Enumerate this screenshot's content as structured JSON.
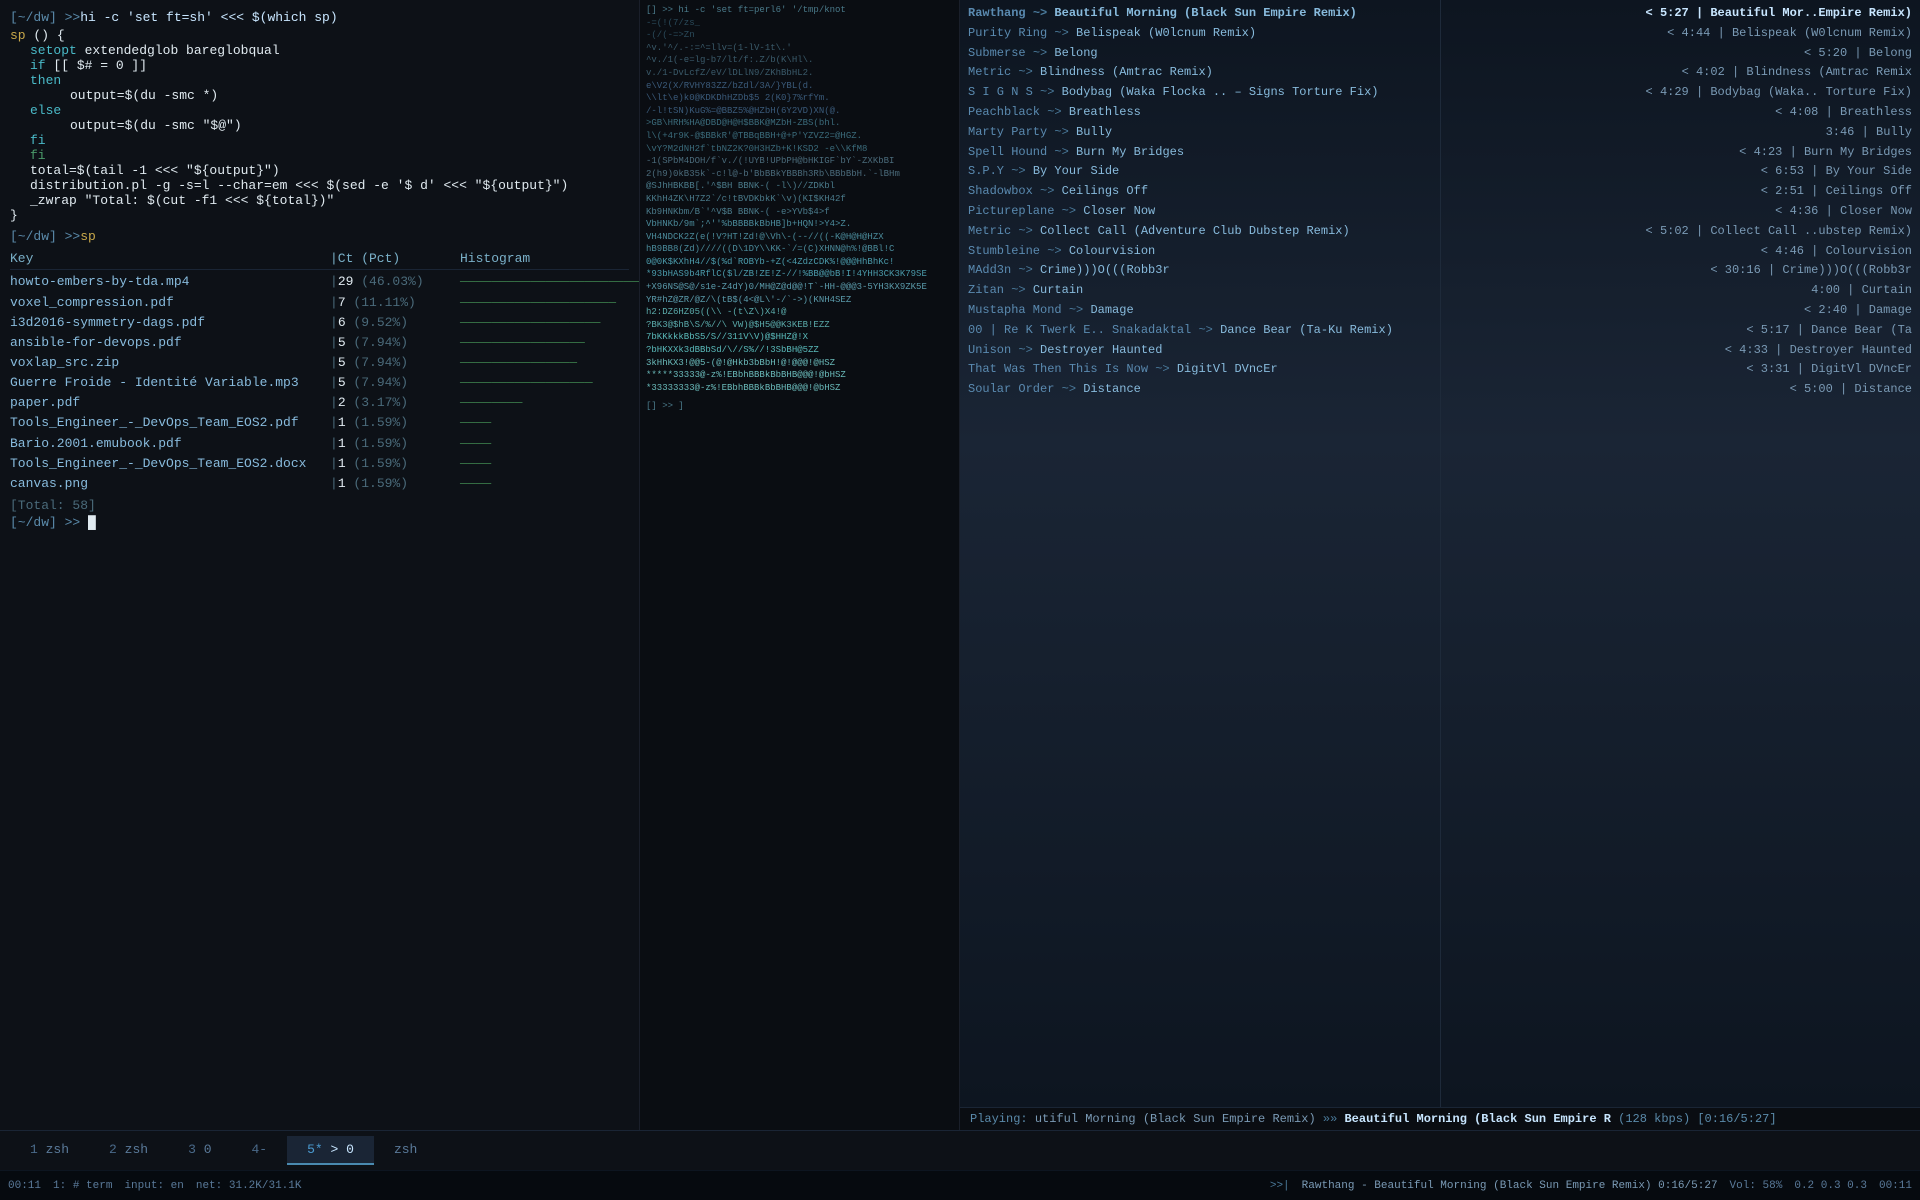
{
  "left_terminal": {
    "lines": [
      {
        "type": "prompt",
        "text": "[~/dw] >> hi -c 'set ft=sh' <<< $(which sp)"
      },
      {
        "type": "code",
        "text": "sp () {"
      },
      {
        "type": "code",
        "text": "    setopt extendedglob bareglobqual"
      },
      {
        "type": "code",
        "text": "    if [[ $# = 0 ]]"
      },
      {
        "type": "code",
        "text": "    then"
      },
      {
        "type": "code",
        "text": "            output=$(du -smc *)"
      },
      {
        "type": "code",
        "text": "    else"
      },
      {
        "type": "code",
        "text": "            output=$(du -smc \"$@\")"
      },
      {
        "type": "code",
        "text": "    fi"
      },
      {
        "type": "keyword",
        "text": "    fi"
      },
      {
        "type": "code",
        "text": "    total=$(tail -1 <<< \"${output}\")"
      },
      {
        "type": "code",
        "text": "    distribution.pl -g -s=l --char=em <<< $(sed -e '$ d' <<< \"${output}\")"
      },
      {
        "type": "code",
        "text": "    _zwrap \"Total: $(cut -f1 <<< ${total})\""
      },
      {
        "type": "code",
        "text": "}"
      },
      {
        "type": "prompt2",
        "text": "[~/dw] >> sp"
      }
    ],
    "sp_output": {
      "header": {
        "key": "Key",
        "ct": "Ct (Pct)",
        "histogram": "Histogram"
      },
      "rows": [
        {
          "key": "howto-embers-by-tda.mp4",
          "ct": "29",
          "pct": "46.03%",
          "bars": 29
        },
        {
          "key": "voxel_compression.pdf",
          "ct": "7",
          "pct": "11.11%",
          "bars": 7
        },
        {
          "key": "i3d2016-symmetry-dags.pdf",
          "ct": "6",
          "pct": "9.52%",
          "bars": 6
        },
        {
          "key": "ansible-for-devops.pdf",
          "ct": "5",
          "pct": "7.94%",
          "bars": 5
        },
        {
          "key": "voxlap_src.zip",
          "ct": "5",
          "pct": "7.94%",
          "bars": 5
        },
        {
          "key": "Guerre Froide - Identité Variable.mp3",
          "ct": "5",
          "pct": "7.94%",
          "bars": 5
        },
        {
          "key": "paper.pdf",
          "ct": "2",
          "pct": "3.17%",
          "bars": 2
        },
        {
          "key": "Tools_Engineer_-_DevOps_Team_EOS2.pdf",
          "ct": "1",
          "pct": "1.59%",
          "bars": 1
        },
        {
          "key": "Bario.2001.emubook.pdf",
          "ct": "1",
          "pct": "1.59%",
          "bars": 1
        },
        {
          "key": "Tools_Engineer_-_DevOps_Team_EOS2.docx",
          "ct": "1",
          "pct": "1.59%",
          "bars": 1
        },
        {
          "key": "canvas.png",
          "ct": "1",
          "pct": "1.59%",
          "bars": 1
        }
      ],
      "total": "[Total: 58]",
      "cursor": "[~/dw] >> "
    }
  },
  "right_terminal": {
    "header": "[] >> hi -c 'set ft=perl6' '/tmp/knot",
    "lines_top": [
      "-=(!(7/zs_",
      "-(/(-=>Zn",
      "^v.'^/.-:=^=llv=(1-lV-1t\\.'",
      "^v./1(-e=lg-b7/lt/f:.Z/b(K\\Hl\\.",
      "v./1-DvLcfZ/eV/lDLlN9/ZKhBbHL2.",
      "e\\V2(X/RVHY83ZZ/bZdl/3A/}YBL(d.",
      "\\\\lt\\e)k0@KDKDhHZDb$5 2(K0}7%rfYm.",
      "/-l!tSN)KuG%=@BBZ5%@HZbH(6Y2VD)XN(@.",
      ">GB\\HRH%HA@DBD@H@H$BBK@MZbH-ZBS(bhl.",
      "l\\(+4r9K-@$BBkR'@TBBqBBH+@+P'YZVZ2=@HGZ.",
      "\\vY?M2dNH2f`tbNZ2K?0H3HZb+K!KSD2-e\\\\KfM8",
      "-1(SPbM4DOH/f`v./(!UYB!UPbPH@bHKIGF`bY`-ZXKbBI",
      "2(h9)0kB35k`-c!l@-b'BbBBkYBBBh3Rb\\BBbBbH.`-lBHm",
      "@SJhHBKBB[.'^$BH BBNK-( -l\\)//ZDKbl",
      "KKhH4ZK\\H7Z2`/c!tBVDKbkK`\\v)(KI$KH42f",
      "Kb9HNKbm/B`'^V$B BBNK-( -e>YVb$4>f",
      "VbHNKb/9m`;^''%bBBBBkBbHB]b+HQN!>Y4>Z.",
      "VH4NDCK2Z(e(!V?HT!Zd!@\\Vh\\-(--//((-K@H@H@HZX",
      "hB9BB8(Zd)////((D\\1DY\\\\KK-`/=(C)XHNN@h%!@BBl!C",
      "0@0K$KXhH4//$(%d`ROBYb-+Z(<4ZdzCDK%!@@@HhBhKc!",
      "*93bHAS9b4RflC($l/ZB!ZE!Z-//!%BB@@bB!I!4YHH3CK3K79SE",
      "+X96NS@S@/s1e-Z4dY)0/MH@Z@d@@!T`-HH-@@@3-5YH3KX9ZK5E",
      "YR#hZ@ZR/@Z/\\(tB$(4<@L\\'-/`->)(KNH4SEZ",
      "h2:DZ6HZ05(((\\ -(t\\Z\\)X4!@",
      "?BK3@$hB\\S/%//\\ VW)@$H5@@K3KEB!EZZ",
      "7bKKkkkBbS5/S//311V\\V)@$HHZ@!X",
      "?bHKXXk3dBBbSd/\\//S%//!3SbBH@5ZZ",
      "3kHhKX3!@@5-(@!@Hkb3bBbH!@!@@@!@HSZ",
      "*****33333@-z%!EBbhBBBkBbBHB@@@!@bHSZ",
      "*33333333@-z%!EBbhBBBkBbBHB@@@!@bHSZ"
    ],
    "separator": "[] >> ]",
    "lines_bottom": []
  },
  "music": {
    "playlist_left": [
      {
        "artist": "Rawthang",
        "arrow": "~>",
        "title": "Beautiful Morning (Black Sun Empire Remix)",
        "active": true
      },
      {
        "artist": "Purity Ring",
        "arrow": "~>",
        "title": "Belispeak (W0lcnum Remix)",
        "active": false
      },
      {
        "artist": "Submerse",
        "arrow": "~>",
        "title": "Belong",
        "active": false
      },
      {
        "artist": "Metric",
        "arrow": "~>",
        "title": "Blindness (Amtrac Remix)",
        "active": false
      },
      {
        "artist": "S I G N S",
        "arrow": "~>",
        "title": "Bodybag (Waka Flocka .. – Signs Torture Fix)",
        "active": false
      },
      {
        "artist": "Peachblack",
        "arrow": "~>",
        "title": "Breathless",
        "active": false
      },
      {
        "artist": "Marty Party",
        "arrow": "~>",
        "title": "Bully",
        "active": false
      },
      {
        "artist": "Spell Hound",
        "arrow": "~>",
        "title": "Burn My Bridges",
        "active": false
      },
      {
        "artist": "S.P.Y",
        "arrow": "~>",
        "title": "By Your Side",
        "active": false
      },
      {
        "artist": "Shadowbox",
        "arrow": "~>",
        "title": "Ceilings Off",
        "active": false
      },
      {
        "artist": "Pictureplane",
        "arrow": "~>",
        "title": "Closer Now",
        "active": false
      },
      {
        "artist": "Metric",
        "arrow": "~>",
        "title": "Collect Call (Adventure Club Dubstep Remix)",
        "active": false
      },
      {
        "artist": "Stumbleine",
        "arrow": "~>",
        "title": "Colourvision",
        "active": false
      },
      {
        "artist": "MAdd3n",
        "arrow": "~>",
        "title": "Crime)))O(((Robb3r",
        "active": false
      },
      {
        "artist": "Zitan",
        "arrow": "~>",
        "title": "Curtain",
        "active": false
      },
      {
        "artist": "Mustapha Mond",
        "arrow": "~>",
        "title": "Damage",
        "active": false
      },
      {
        "artist": "00 | Re K Twerk E.. Snakadaktal",
        "arrow": "~>",
        "title": "Dance Bear (Ta-Ku Remix)",
        "active": false
      },
      {
        "artist": "Unison",
        "arrow": "~>",
        "title": "Destroyer Haunted",
        "active": false
      },
      {
        "artist": "That Was Then This Is Now",
        "arrow": "~>",
        "title": "DigitVl DVncEr",
        "active": false
      },
      {
        "artist": "Soular Order",
        "arrow": "~>",
        "title": "Distance",
        "active": false
      }
    ],
    "playlist_right": [
      {
        "time": "< 5:27",
        "label": "Beautiful Mor..Empire Remix)"
      },
      {
        "time": "< 4:44",
        "label": "Belispeak (W0lcnum Remix)"
      },
      {
        "time": "< 5:20",
        "label": "Belong"
      },
      {
        "time": "< 4:02",
        "label": "Blindness (Amtrac Remix"
      },
      {
        "time": "< 4:29",
        "label": "Bodybag (Waka.. Torture Fix)"
      },
      {
        "time": "",
        "label": "< 4:08 | Breathless"
      },
      {
        "time": "",
        "label": "3:46 | Bully"
      },
      {
        "time": "< 4:23",
        "label": "Burn My Bridges"
      },
      {
        "time": "< 6:53",
        "label": "By Your Side"
      },
      {
        "time": "< 2:51",
        "label": "Ceilings Off"
      },
      {
        "time": "< 4:36",
        "label": "Closer Now"
      },
      {
        "time": "< 5:02",
        "label": "Collect Call ..ubstep Remix)"
      },
      {
        "time": "< 4:46",
        "label": "Colourvision"
      },
      {
        "time": "< 30:16",
        "label": "Crime)))O(((Robb3r"
      },
      {
        "time": "",
        "label": "4:00 | Curtain"
      },
      {
        "time": "< 2:40",
        "label": "Damage"
      },
      {
        "time": "< 5:17",
        "label": "Dance Bear (Ta"
      },
      {
        "time": "< 4:33",
        "label": "Destroyer Haunted"
      },
      {
        "time": "< 3:31",
        "label": "DigitVl DVncEr"
      },
      {
        "time": "< 5:00",
        "label": "Distance"
      }
    ],
    "now_playing": {
      "label": "Playing:",
      "song": "utiful Morning (Black Sun Empire Remix)",
      "arrows": ">>>",
      "next": "Beautiful Morning (Black Sun Empire R",
      "bitrate": "(128 kbps)",
      "position": "[0:16/5:27]"
    }
  },
  "tabs": [
    {
      "number": "1",
      "label": "zsh",
      "active": false
    },
    {
      "number": "2",
      "label": "zsh",
      "active": false
    },
    {
      "number": "3",
      "label": "0",
      "active": false
    },
    {
      "number": "4-",
      "label": "",
      "active": false
    },
    {
      "number": "5*",
      "label": "> 0",
      "active": true
    },
    {
      "number": "",
      "label": "zsh",
      "active": false
    }
  ],
  "status_bar": {
    "time": "00:11",
    "pane": "1: # term",
    "input": "input: en",
    "net": "net: 31.2K/31.1K",
    "music_status": "Rawthang - Beautiful Morning (Black Sun Empire Remix) 0:16/5:27",
    "vol": "Vol: 58%",
    "equalizer": "0.2  0.3  0.3",
    "clock": "00:11"
  }
}
